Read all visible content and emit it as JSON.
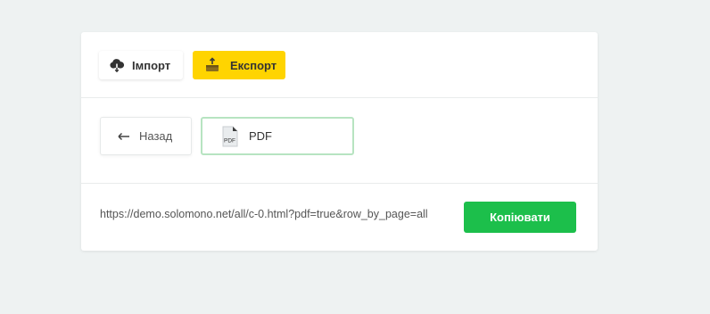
{
  "tabs": {
    "import_label": "Імпорт",
    "import_icon": "cloud-download-icon",
    "export_label": "Експорт",
    "export_icon": "box-upload-icon",
    "export_bg": "#ffd400"
  },
  "format": {
    "back_label": "Назад",
    "back_icon": "arrow-left-icon",
    "pdf_label": "PDF",
    "pdf_icon": "pdf-file-icon",
    "pdf_border": "#b7e4c1"
  },
  "link": {
    "url": "https://demo.solomono.net/all/c-0.html?pdf=true&row_by_page=all",
    "copy_label": "Копіювати",
    "copy_bg": "#1cbf4b"
  }
}
